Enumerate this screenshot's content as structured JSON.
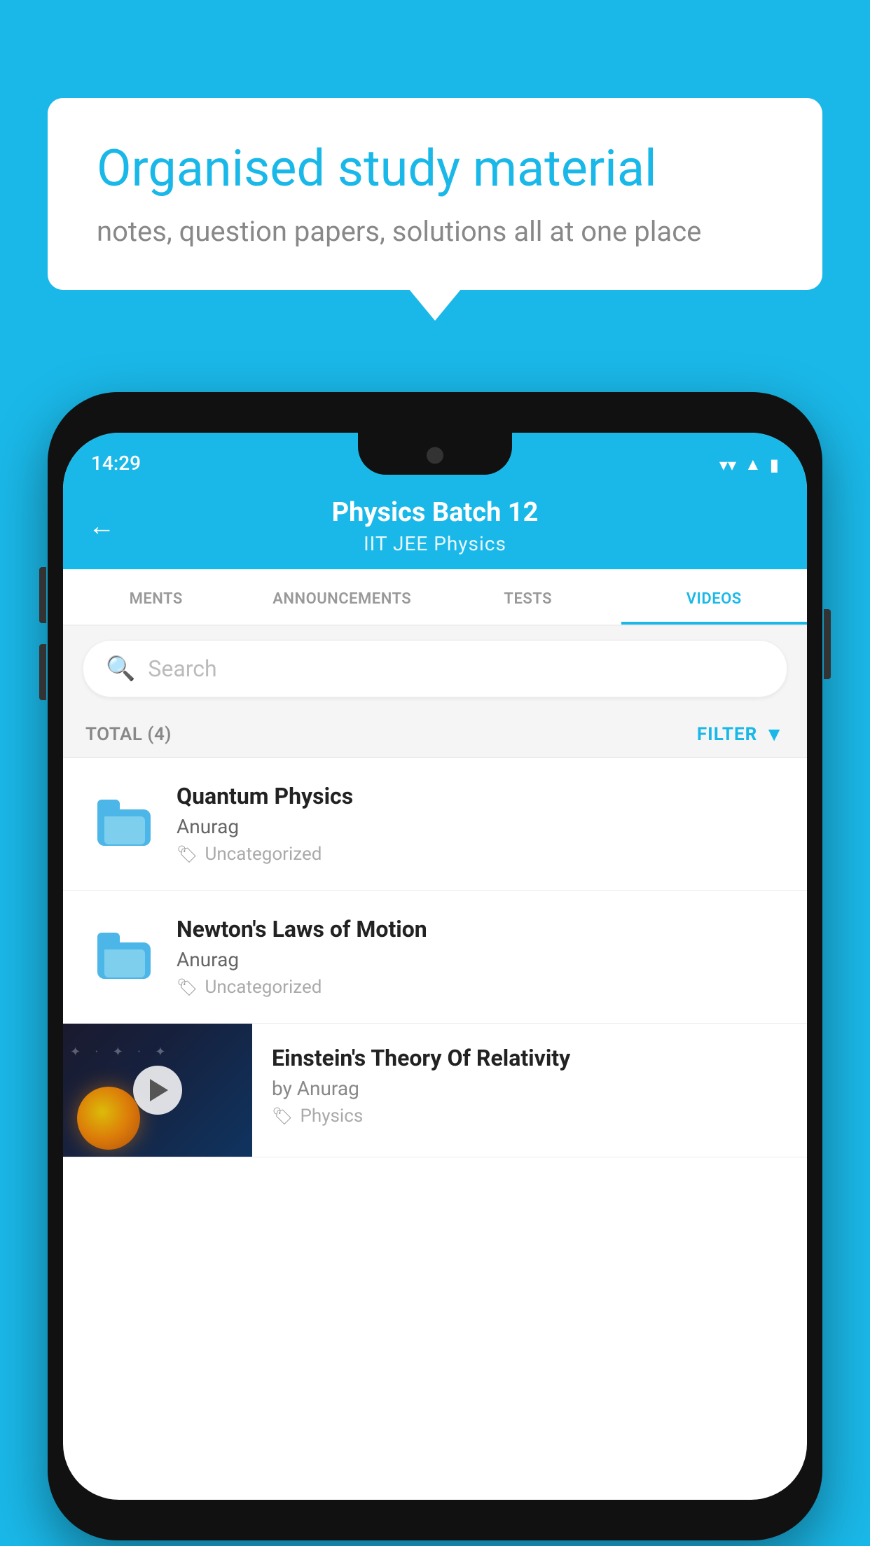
{
  "background": {
    "color": "#1ab8e8"
  },
  "bubble": {
    "title": "Organised study material",
    "subtitle": "notes, question papers, solutions all at one place"
  },
  "phone": {
    "status_bar": {
      "time": "14:29"
    },
    "header": {
      "title": "Physics Batch 12",
      "subtitle": "IIT JEE   Physics",
      "back_label": "←"
    },
    "tabs": [
      {
        "label": "MENTS",
        "active": false
      },
      {
        "label": "ANNOUNCEMENTS",
        "active": false
      },
      {
        "label": "TESTS",
        "active": false
      },
      {
        "label": "VIDEOS",
        "active": true
      }
    ],
    "search": {
      "placeholder": "Search"
    },
    "filter_bar": {
      "total_label": "TOTAL (4)",
      "filter_label": "FILTER"
    },
    "list_items": [
      {
        "title": "Quantum Physics",
        "author": "Anurag",
        "tag": "Uncategorized",
        "has_thumb": false
      },
      {
        "title": "Newton's Laws of Motion",
        "author": "Anurag",
        "tag": "Uncategorized",
        "has_thumb": false
      },
      {
        "title": "Einstein's Theory Of Relativity",
        "author": "by Anurag",
        "tag": "Physics",
        "has_thumb": true
      }
    ]
  }
}
